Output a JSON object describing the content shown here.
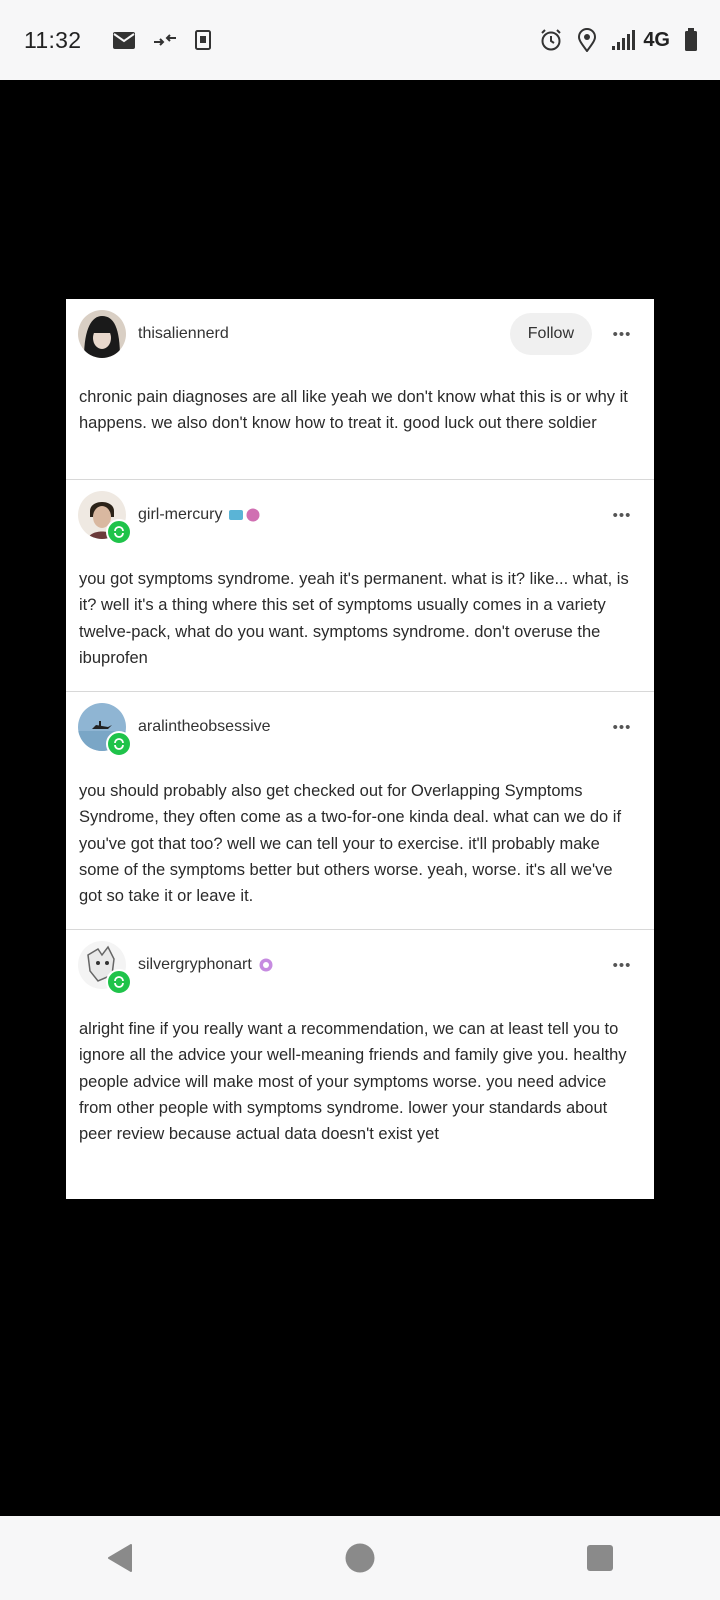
{
  "status_bar": {
    "time": "11:32",
    "left_icons": [
      "mail-icon",
      "data-transfer-icon",
      "kindle-icon"
    ],
    "right_icons": [
      "alarm-icon",
      "location-icon",
      "signal-icon",
      "battery-icon"
    ],
    "network": "4G"
  },
  "post": {
    "follow_label": "Follow",
    "entries": [
      {
        "username": "thisaliennerd",
        "text": "chronic pain diagnoses are all like yeah we don't know what this is or why it happens. we also don't know how to treat it. good luck out there soldier"
      },
      {
        "username": "girl-mercury",
        "text": "you got symptoms syndrome. yeah it's permanent. what is it? like... what, is it? well it's a thing where this set of symptoms usually comes in a variety twelve-pack, what do you want. symptoms syndrome. don't overuse the ibuprofen"
      },
      {
        "username": "aralintheobsessive",
        "text": "you should probably also get checked out for Overlapping Symptoms Syndrome, they often come as a two-for-one kinda deal. what can we do if you've got that too? well we can tell your to exercise. it'll probably make some of the symptoms better but others worse. yeah, worse. it's all we've got so take it or leave it."
      },
      {
        "username": "silvergryphonart",
        "text": "alright fine if you really want a recommendation, we can at least tell you to ignore all the advice your well-meaning friends and family give you. healthy people advice will make most of your symptoms worse. you need advice from other people with symptoms syndrome. lower your standards about peer review because actual data doesn't exist yet"
      }
    ]
  },
  "nav_bar": {
    "buttons": [
      "back-icon",
      "home-icon",
      "recents-icon"
    ]
  }
}
